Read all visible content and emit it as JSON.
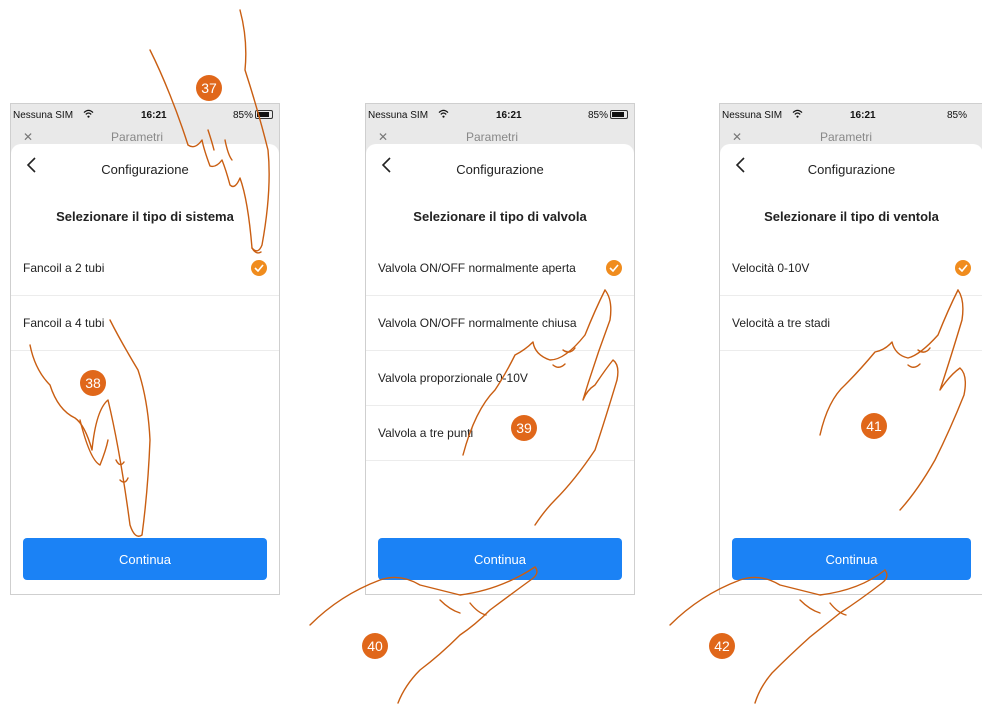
{
  "colors": {
    "accent": "#f08c1e",
    "button": "#1b82f5",
    "badge": "#e0671a",
    "hand_stroke": "#c95e12"
  },
  "panels": [
    {
      "status": {
        "carrier": "Nessuna SIM",
        "time": "16:21",
        "battery": "85%"
      },
      "behind_title": "Parametri",
      "sheet_title": "Configurazione",
      "question": "Selezionare il tipo di sistema",
      "options": [
        {
          "label": "Fancoil a 2 tubi",
          "selected": true
        },
        {
          "label": "Fancoil a 4 tubi",
          "selected": false
        }
      ],
      "button": "Continua"
    },
    {
      "status": {
        "carrier": "Nessuna SIM",
        "time": "16:21",
        "battery": "85%"
      },
      "behind_title": "Parametri",
      "sheet_title": "Configurazione",
      "question": "Selezionare il tipo di valvola",
      "options": [
        {
          "label": "Valvola ON/OFF normalmente aperta",
          "selected": true
        },
        {
          "label": "Valvola ON/OFF normalmente chiusa",
          "selected": false
        },
        {
          "label": "Valvola proporzionale 0-10V",
          "selected": false
        },
        {
          "label": "Valvola a tre punti",
          "selected": false
        }
      ],
      "button": "Continua"
    },
    {
      "status": {
        "carrier": "Nessuna SIM",
        "time": "16:21",
        "battery": "85%"
      },
      "behind_title": "Parametri",
      "sheet_title": "Configurazione",
      "question": "Selezionare il tipo di ventola",
      "options": [
        {
          "label": "Velocità 0-10V",
          "selected": true
        },
        {
          "label": "Velocità a tre stadi",
          "selected": false
        }
      ],
      "button": "Continua"
    }
  ],
  "badges": [
    "37",
    "38",
    "39",
    "40",
    "41",
    "42"
  ]
}
